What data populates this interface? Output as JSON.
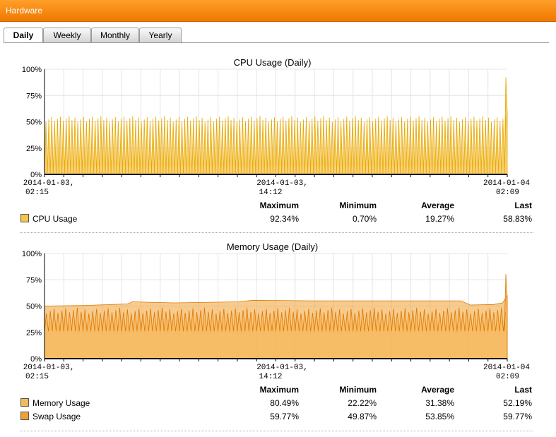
{
  "header": {
    "title": "Hardware"
  },
  "tabs": [
    {
      "label": "Daily",
      "active": true
    },
    {
      "label": "Weekly",
      "active": false
    },
    {
      "label": "Monthly",
      "active": false
    },
    {
      "label": "Yearly",
      "active": false
    }
  ],
  "colors": {
    "header": "#f58a14",
    "cpu": "#f7c34a",
    "cpu_stroke": "#e8a800",
    "memory": "#f5b85a",
    "swap": "#f0a030",
    "swap_stroke": "#e07800"
  },
  "stat_headers": [
    "Maximum",
    "Minimum",
    "Average",
    "Last"
  ],
  "chart_data": [
    {
      "type": "area",
      "title": "CPU Usage (Daily)",
      "yticks": [
        "100%",
        "75%",
        "50%",
        "25%",
        "0%"
      ],
      "ylim": [
        0,
        100
      ],
      "xticks": [
        "2014-01-03, 02:15",
        "2014-01-03, 14:12",
        "2014-01-04 02:09"
      ],
      "grid": true,
      "series": [
        {
          "name": "CPU Usage",
          "pattern": "spikes",
          "base": 1,
          "peak": 52,
          "last_peak": 92.34,
          "last": 58.83,
          "stats": [
            "92.34%",
            "0.70%",
            "19.27%",
            "58.83%"
          ]
        }
      ]
    },
    {
      "type": "area",
      "title": "Memory Usage (Daily)",
      "yticks": [
        "100%",
        "75%",
        "50%",
        "25%",
        "0%"
      ],
      "ylim": [
        0,
        100
      ],
      "xticks": [
        "2014-01-03, 02:15",
        "2014-01-03, 14:12",
        "2014-01-04 02:09"
      ],
      "grid": true,
      "series": [
        {
          "name": "Memory Usage",
          "pattern": "spikes",
          "base": 26,
          "peak": 45,
          "last_peak": 80.49,
          "last": 52.19,
          "stats": [
            "80.49%",
            "22.22%",
            "31.38%",
            "52.19%"
          ]
        },
        {
          "name": "Swap Usage",
          "pattern": "smooth",
          "points": [
            [
              0,
              50
            ],
            [
              8,
              50.5
            ],
            [
              18,
              52
            ],
            [
              19,
              54
            ],
            [
              28,
              53
            ],
            [
              42,
              54
            ],
            [
              45,
              55.5
            ],
            [
              58,
              55
            ],
            [
              70,
              55
            ],
            [
              90,
              55
            ],
            [
              92,
              51
            ],
            [
              97,
              51.5
            ],
            [
              99,
              53
            ],
            [
              100,
              59.77
            ]
          ],
          "stats": [
            "59.77%",
            "49.87%",
            "53.85%",
            "59.77%"
          ]
        }
      ]
    }
  ]
}
